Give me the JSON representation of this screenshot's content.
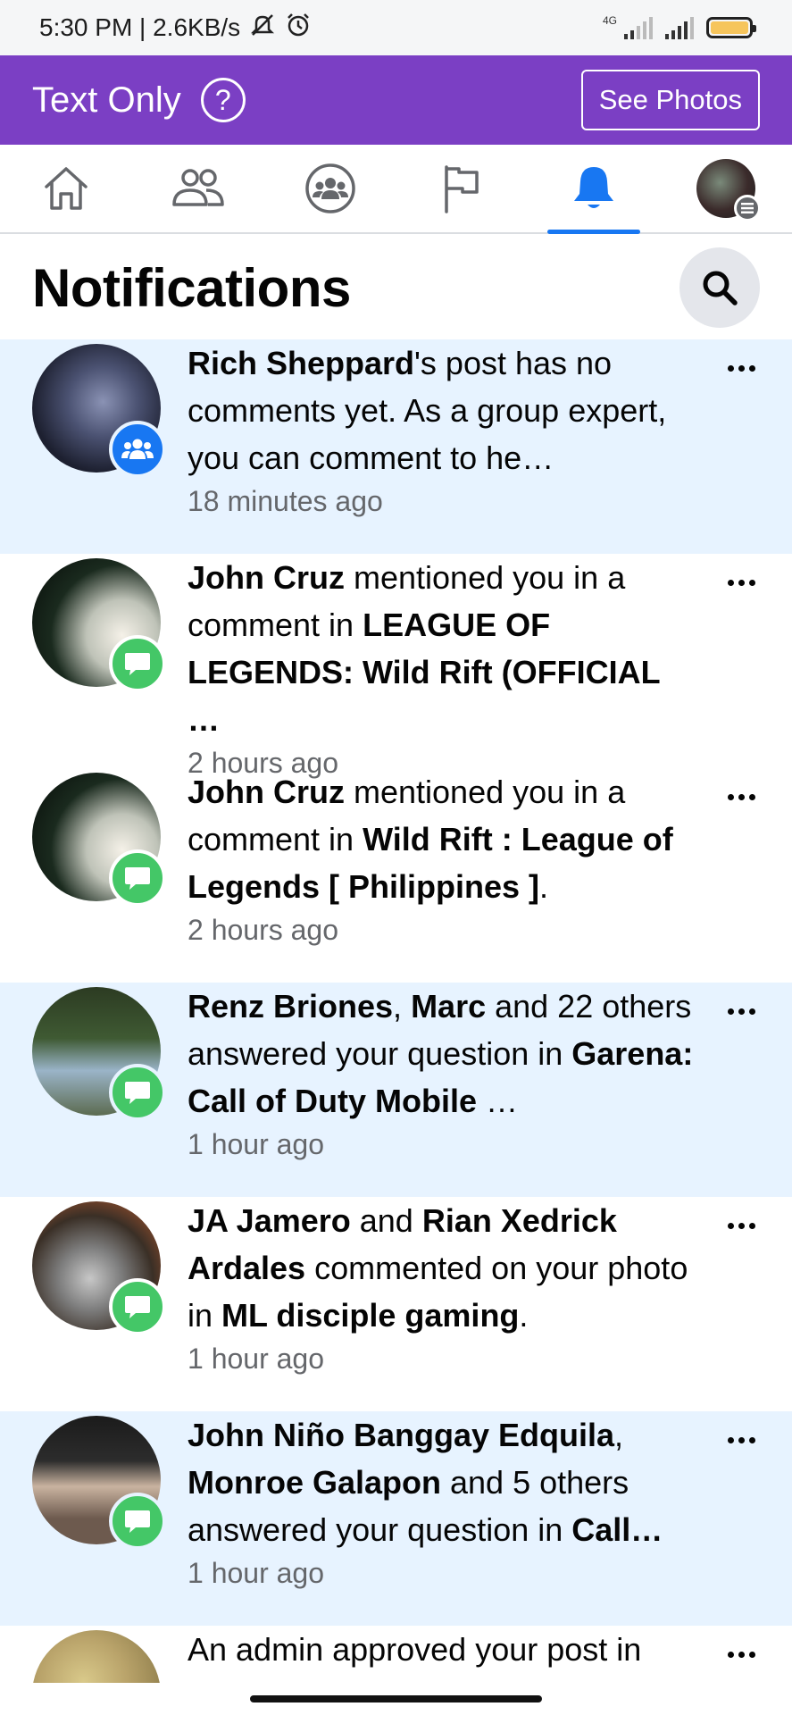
{
  "status_bar": {
    "left_text": "5:30 PM | 2.6KB/s",
    "network_label": "4G",
    "icons": [
      "mute-icon",
      "alarm-icon",
      "signal-icon",
      "signal-icon",
      "battery-icon"
    ]
  },
  "top_bar": {
    "title": "Text Only",
    "help_glyph": "?",
    "see_photos_label": "See Photos",
    "color": "#7b3fc4"
  },
  "nav": {
    "items": [
      "home-icon",
      "friends-icon",
      "groups-icon",
      "pages-icon",
      "notifications-icon",
      "menu-avatar"
    ],
    "active": "notifications-icon",
    "accent": "#1877f2"
  },
  "header": {
    "title": "Notifications"
  },
  "notifications": [
    {
      "unread": true,
      "badge": "group",
      "parts": [
        [
          "b",
          "Rich Sheppard"
        ],
        [
          "t",
          "'s post has no comments yet. As a group expert, you can comment to he…"
        ]
      ],
      "time": "18 minutes ago"
    },
    {
      "unread": false,
      "badge": "comment",
      "parts": [
        [
          "b",
          "John Cruz"
        ],
        [
          "t",
          " mentioned you in a comment in "
        ],
        [
          "b",
          "LEAGUE OF LEGENDS: Wild Rift (OFFICIAL …"
        ]
      ],
      "time": "2 hours ago"
    },
    {
      "unread": false,
      "badge": "comment",
      "parts": [
        [
          "b",
          "John Cruz"
        ],
        [
          "t",
          " mentioned you in a comment in "
        ],
        [
          "b",
          "Wild Rift : League of Legends [ Philippines ]"
        ],
        [
          "t",
          "."
        ]
      ],
      "time": "2 hours ago"
    },
    {
      "unread": true,
      "badge": "comment",
      "parts": [
        [
          "b",
          "Renz Briones"
        ],
        [
          "t",
          ", "
        ],
        [
          "b",
          "Marc"
        ],
        [
          "t",
          " and 22 others answered your question in "
        ],
        [
          "b",
          "Garena: Call of Duty Mobile"
        ],
        [
          "t",
          " …"
        ]
      ],
      "time": "1 hour ago"
    },
    {
      "unread": false,
      "badge": "comment",
      "parts": [
        [
          "b",
          "JA Jamero"
        ],
        [
          "t",
          " and "
        ],
        [
          "b",
          "Rian Xedrick Ardales"
        ],
        [
          "t",
          " commented on your photo in "
        ],
        [
          "b",
          "ML disciple gaming"
        ],
        [
          "t",
          "."
        ]
      ],
      "time": "1 hour ago"
    },
    {
      "unread": true,
      "badge": "comment",
      "parts": [
        [
          "b",
          "John Niño Banggay Edquila"
        ],
        [
          "t",
          ", "
        ],
        [
          "b",
          "Monroe Galapon"
        ],
        [
          "t",
          " and 5 others answered your question in "
        ],
        [
          "b",
          "Call…"
        ]
      ],
      "time": "1 hour ago"
    },
    {
      "unread": false,
      "badge": "none",
      "parts": [
        [
          "t",
          "An admin approved your post in"
        ]
      ],
      "time": ""
    }
  ]
}
